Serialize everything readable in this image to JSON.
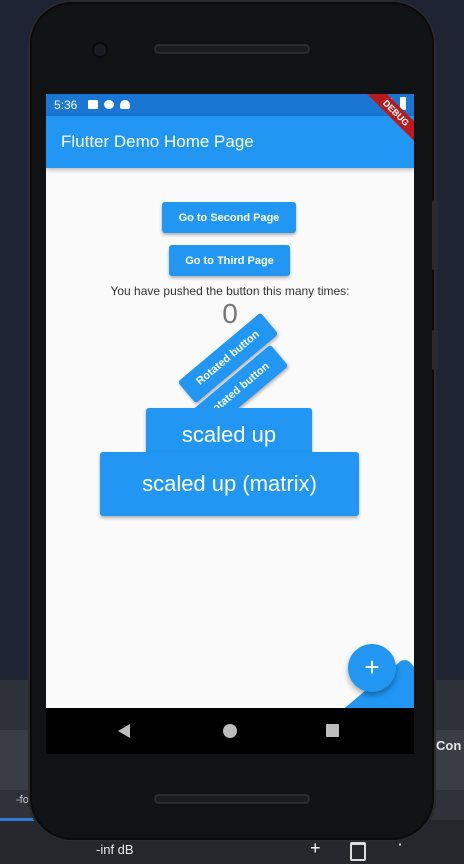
{
  "status_bar": {
    "time": "5:36"
  },
  "app_bar": {
    "title": "Flutter Demo Home Page",
    "debug_banner": "DEBUG"
  },
  "buttons": {
    "second_page": "Go to Second Page",
    "third_page": "Go to Third Page",
    "rotated_1": "Rotated button",
    "rotated_2": "Rotated button",
    "scaled_up": "scaled up",
    "scaled_up_matrix": "scaled up (matrix)"
  },
  "counter": {
    "label": "You have pushed the button this many times:",
    "value": "0"
  },
  "fab": {
    "label": "+"
  },
  "desktop": {
    "panel_label": "Con",
    "volume": "-inf dB",
    "left_label": "-fo"
  },
  "colors": {
    "primary": "#2196f3",
    "status_bar": "#1976d2",
    "debug": "#b71c1c"
  }
}
